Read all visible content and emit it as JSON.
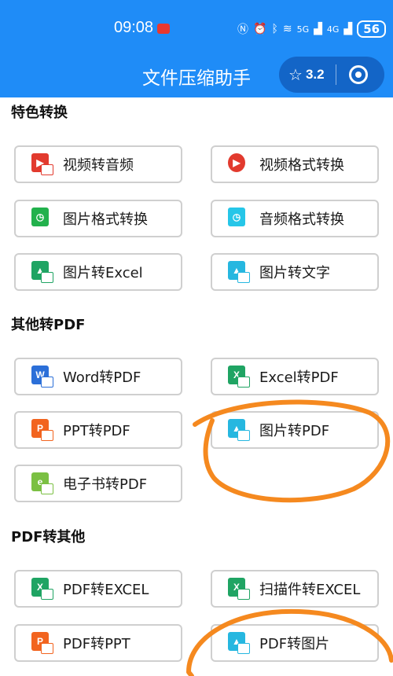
{
  "status_bar": {
    "time": "09:08",
    "network_5g": "5G",
    "network_4g": "4G",
    "battery": "56"
  },
  "header": {
    "title": "文件压缩助手",
    "rating": "3.2",
    "colors": {
      "bar": "#1f8cf7"
    }
  },
  "sections": {
    "special": {
      "title": "特色转换",
      "items": {
        "video_to_audio": "视频转音频",
        "video_format": "视频格式转换",
        "image_format": "图片格式转换",
        "audio_format": "音频格式转换",
        "image_to_excel": "图片转Excel",
        "image_to_text": "图片转文字"
      }
    },
    "to_pdf": {
      "title": "其他转PDF",
      "items": {
        "word_to_pdf": "Word转PDF",
        "excel_to_pdf": "Excel转PDF",
        "ppt_to_pdf": "PPT转PDF",
        "image_to_pdf": "图片转PDF",
        "ebook_to_pdf": "电子书转PDF"
      }
    },
    "from_pdf": {
      "title": "PDF转其他",
      "items": {
        "pdf_to_excel": "PDF转EXCEL",
        "scan_to_excel": "扫描件转EXCEL",
        "pdf_to_ppt": "PDF转PPT",
        "pdf_to_image": "PDF转图片"
      }
    }
  },
  "icons": {
    "video_to_audio": "video-audio-icon",
    "video_format": "video-format-icon",
    "image_format": "image-format-icon",
    "audio_format": "audio-format-icon",
    "image_to_excel": "image-excel-icon",
    "image_to_text": "image-text-icon",
    "word_to_pdf": "word-pdf-icon",
    "excel_to_pdf": "excel-pdf-icon",
    "ppt_to_pdf": "ppt-pdf-icon",
    "image_to_pdf": "image-pdf-icon",
    "ebook_to_pdf": "ebook-pdf-icon",
    "pdf_to_excel": "pdf-excel-icon",
    "scan_to_excel": "scan-excel-icon",
    "pdf_to_ppt": "pdf-ppt-icon",
    "pdf_to_image": "pdf-image-icon"
  },
  "annotation_color": "#f5891f"
}
